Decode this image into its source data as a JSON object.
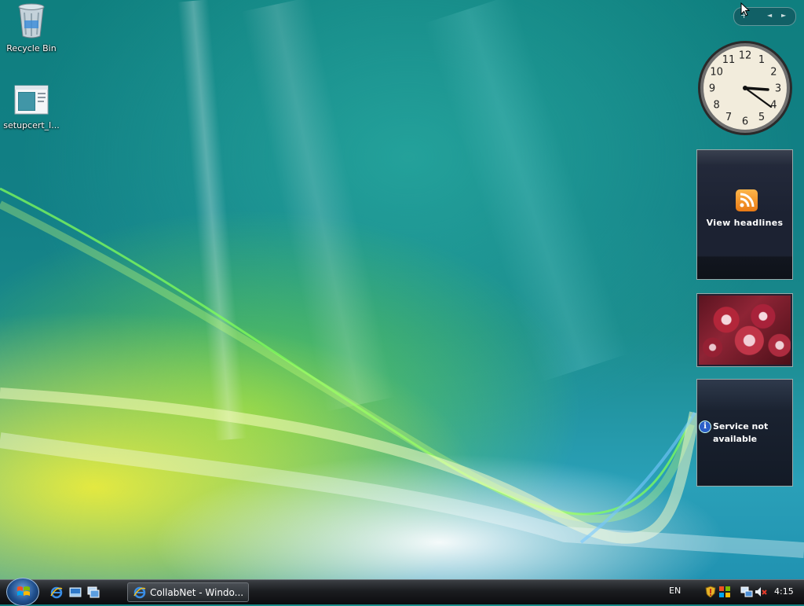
{
  "desktop": {
    "icons": [
      {
        "label": "Recycle Bin",
        "icon": "recycle-bin-icon"
      },
      {
        "label": "setupcert_l...",
        "icon": "installer-file-icon"
      }
    ]
  },
  "sidebar": {
    "toolbar": {
      "add": "+",
      "prev": "◄",
      "next": "►"
    },
    "clock": {
      "numbers": [
        "12",
        "1",
        "2",
        "3",
        "4",
        "5",
        "6",
        "7",
        "8",
        "9",
        "10",
        "11"
      ],
      "time": "4:15"
    },
    "feeds": {
      "label": "View headlines",
      "icon": "rss-icon"
    },
    "slideshow": {
      "icon": "slideshow-photo"
    },
    "weather": {
      "message": "Service not available",
      "icon": "info-icon"
    }
  },
  "taskbar": {
    "start_icon": "windows-orb-icon",
    "quick_launch": [
      "internet-explorer-icon",
      "show-desktop-icon",
      "switch-windows-icon"
    ],
    "active_window": "CollabNet - Windo...",
    "language": "EN",
    "tray": [
      "security-shield-icon",
      "windows-update-icon",
      "network-icon",
      "volume-muted-icon"
    ],
    "clock": "4:15"
  },
  "colors": {
    "taskbar": "#1b1d20",
    "rss": "#f28c28",
    "accent": "#1f4f8e"
  }
}
